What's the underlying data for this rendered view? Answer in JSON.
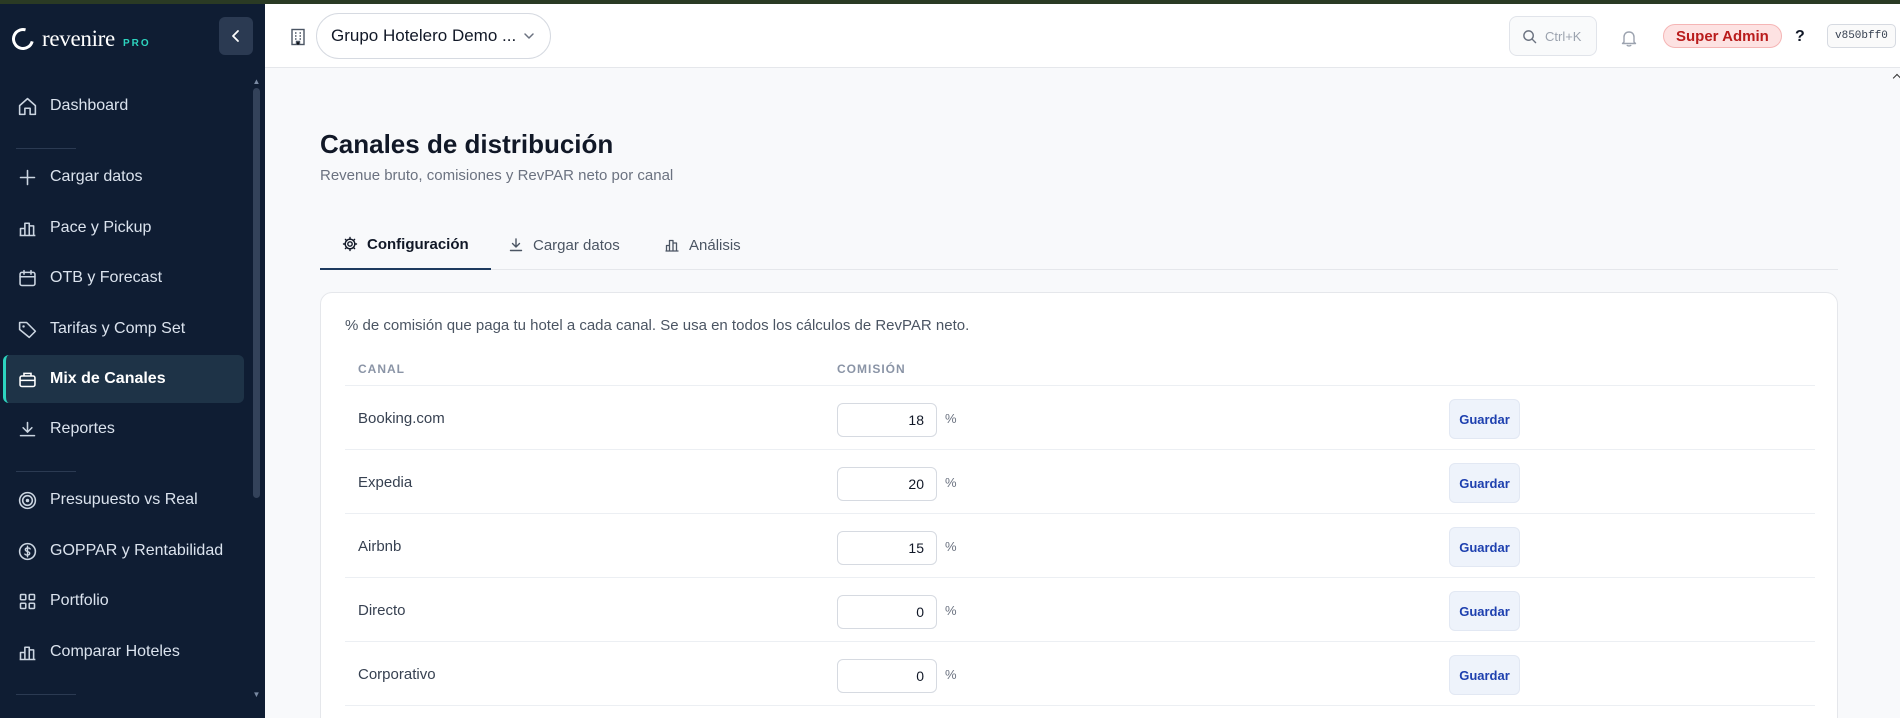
{
  "brand": {
    "name": "revenire",
    "badge": "PRO"
  },
  "sidebar": {
    "items": [
      {
        "label": "Dashboard",
        "icon": "home-icon"
      },
      {
        "label": "Cargar datos",
        "icon": "plus-icon"
      },
      {
        "label": "Pace y Pickup",
        "icon": "bar-chart-icon"
      },
      {
        "label": "OTB y Forecast",
        "icon": "calendar-icon"
      },
      {
        "label": "Tarifas y Comp Set",
        "icon": "tag-icon"
      },
      {
        "label": "Mix de Canales",
        "icon": "briefcase-icon",
        "active": true
      },
      {
        "label": "Reportes",
        "icon": "download-icon"
      },
      {
        "label": "Presupuesto vs Real",
        "icon": "target-icon"
      },
      {
        "label": "GOPPAR y Rentabilidad",
        "icon": "dollar-icon"
      },
      {
        "label": "Portfolio",
        "icon": "grid-icon"
      },
      {
        "label": "Comparar Hoteles",
        "icon": "bar-chart-icon"
      }
    ]
  },
  "header": {
    "hotel": "Grupo Hotelero Demo ...",
    "search_shortcut": "Ctrl+K",
    "role_badge": "Super Admin",
    "help": "?",
    "version": "v850bff0"
  },
  "page": {
    "title": "Canales de distribución",
    "subtitle": "Revenue bruto, comisiones y RevPAR neto por canal"
  },
  "tabs": [
    {
      "label": "Configuración",
      "icon": "gear-icon",
      "active": true
    },
    {
      "label": "Cargar datos",
      "icon": "download-icon"
    },
    {
      "label": "Análisis",
      "icon": "bar-chart-icon"
    }
  ],
  "card": {
    "description": "% de comisión que paga tu hotel a cada canal. Se usa en todos los cálculos de RevPAR neto.",
    "columns": {
      "channel": "CANAL",
      "commission": "COMISIÓN"
    },
    "pct_symbol": "%",
    "save_label": "Guardar",
    "rows": [
      {
        "channel": "Booking.com",
        "commission": "18"
      },
      {
        "channel": "Expedia",
        "commission": "20"
      },
      {
        "channel": "Airbnb",
        "commission": "15"
      },
      {
        "channel": "Directo",
        "commission": "0"
      },
      {
        "channel": "Corporativo",
        "commission": "0"
      }
    ]
  },
  "colors": {
    "sidebar_bg": "#0f1d33",
    "accent": "#2dd4bf",
    "badge_bg": "#fde2e2",
    "badge_text": "#b91c1c",
    "button_text": "#1e40af"
  }
}
